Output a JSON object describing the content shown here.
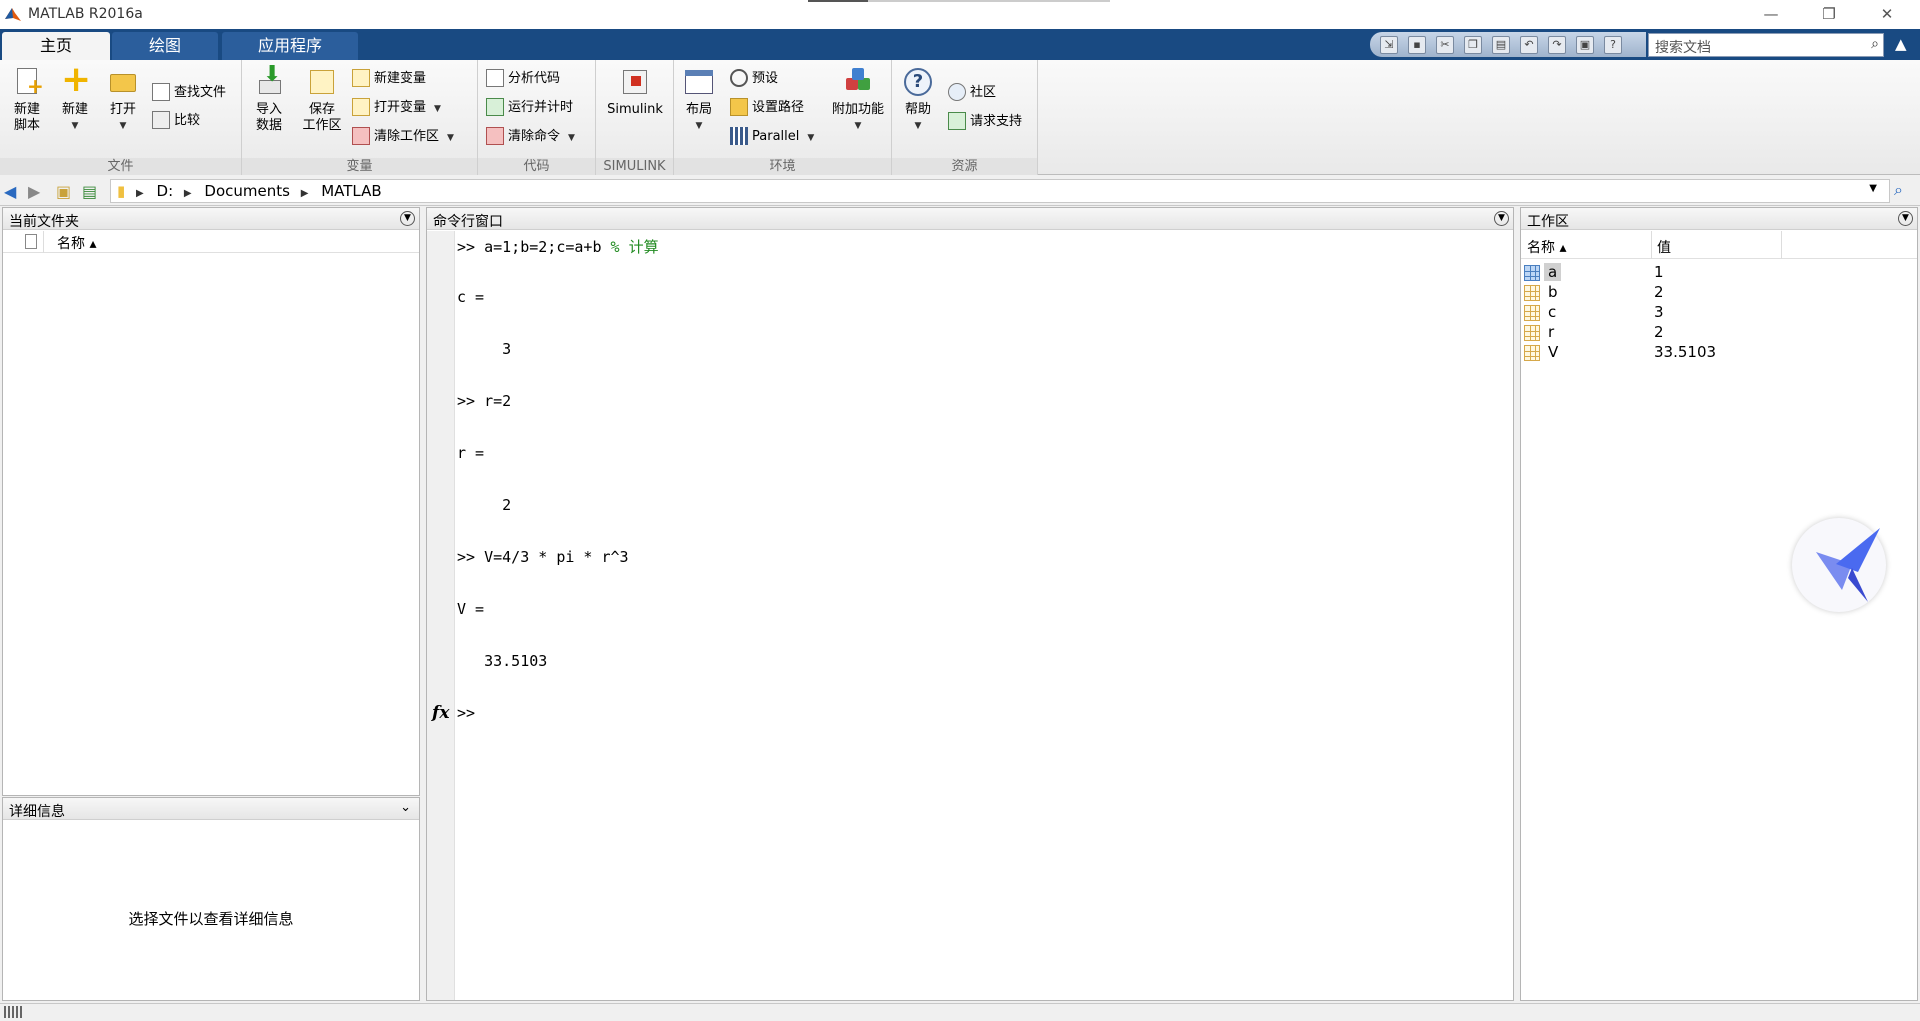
{
  "window": {
    "title": "MATLAB R2016a",
    "min": "—",
    "restore": "❐",
    "close": "✕"
  },
  "tabs": [
    {
      "label": "主页",
      "active": true
    },
    {
      "label": "绘图",
      "active": false
    },
    {
      "label": "应用程序",
      "active": false
    }
  ],
  "search": {
    "placeholder": "搜索文档"
  },
  "ribbon": {
    "file": {
      "group_label": "文件",
      "new_script": [
        "新建",
        "脚本"
      ],
      "new": "新建",
      "open": "打开",
      "find_files": "查找文件",
      "compare": "比较"
    },
    "variable": {
      "group_label": "变量",
      "import": [
        "导入",
        "数据"
      ],
      "save_ws": [
        "保存",
        "工作区"
      ],
      "new_var": "新建变量",
      "open_var": "打开变量",
      "clear_ws": "清除工作区"
    },
    "code": {
      "group_label": "代码",
      "analyze": "分析代码",
      "run_time": "运行并计时",
      "clear_cmd": "清除命令"
    },
    "simulink": {
      "group_label": "SIMULINK",
      "simulink": "Simulink"
    },
    "env": {
      "group_label": "环境",
      "layout": "布局",
      "prefs": "预设",
      "set_path": "设置路径",
      "parallel": "Parallel",
      "addons": "附加功能"
    },
    "resources": {
      "group_label": "资源",
      "help": "帮助",
      "community": "社区",
      "support": "请求支持"
    }
  },
  "path": [
    "D:",
    "Documents",
    "MATLAB"
  ],
  "current_folder": {
    "title": "当前文件夹",
    "col_name": "名称 ▴"
  },
  "details": {
    "title": "详细信息",
    "message": "选择文件以查看详细信息"
  },
  "command_window": {
    "title": "命令行窗口",
    "lines": [
      {
        "text": ">> a=1;b=2;c=a+b ",
        "comment": "% 计算"
      },
      {
        "text": "c ="
      },
      {
        "text": "     3"
      },
      {
        "text": ">> r=2"
      },
      {
        "text": "r ="
      },
      {
        "text": "     2"
      },
      {
        "text": ">> V=4/3 * pi * r^3"
      },
      {
        "text": "V ="
      },
      {
        "text": "   33.5103"
      },
      {
        "text": ">>"
      }
    ],
    "fx": "fx"
  },
  "workspace": {
    "title": "工作区",
    "col_name": "名称 ▴",
    "col_value": "值",
    "vars": [
      {
        "name": "a",
        "value": "1"
      },
      {
        "name": "b",
        "value": "2"
      },
      {
        "name": "c",
        "value": "3"
      },
      {
        "name": "r",
        "value": "2"
      },
      {
        "name": "V",
        "value": "33.5103"
      }
    ]
  }
}
